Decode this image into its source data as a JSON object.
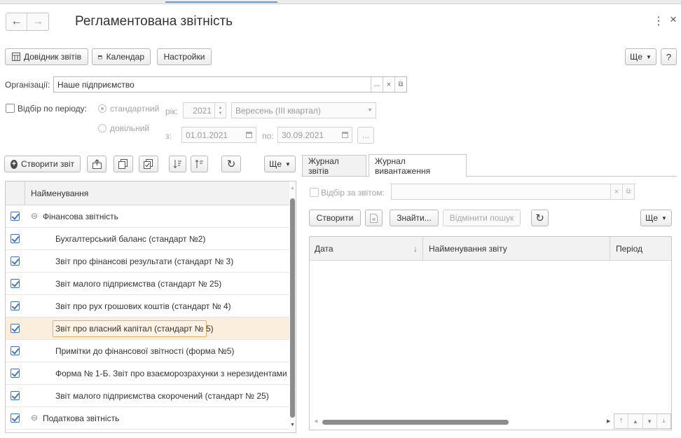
{
  "window": {
    "title": "Регламентована звітність",
    "back_icon": "←",
    "forward_icon": "→",
    "more_icon": "⋮",
    "close_icon": "×"
  },
  "toolbar": {
    "reports_ref_label": "Довідник звітів",
    "calendar_label": "Календар",
    "settings_label": "Настройки",
    "more_label": "Ще",
    "help_label": "?"
  },
  "organization": {
    "label": "Організації:",
    "value": "Наше підприємство",
    "select_icon": "...",
    "clear_icon": "×",
    "open_icon": "⧉"
  },
  "period_filter": {
    "checkbox_label": "Відбір по періоду:",
    "standard_label": "стандартний",
    "custom_label": "довільний",
    "year_label": "рік:",
    "year_value": "2021",
    "quarter_value": "Вересень (III квартал)",
    "from_label": "з:",
    "from_value": "01.01.2021",
    "to_label": "по:",
    "to_value": "30.09.2021",
    "ellipsis": "..."
  },
  "left_toolbar": {
    "create_label": "Створити звіт",
    "more_label": "Ще"
  },
  "tree": {
    "column_header": "Найменування",
    "rows": [
      {
        "label": "Фінансова звітність",
        "group": true,
        "checked": true
      },
      {
        "label": "Бухгалтерський баланс (стандарт №2)",
        "group": false,
        "checked": true
      },
      {
        "label": "Звіт про фінансові результати (стандарт № 3)",
        "group": false,
        "checked": true
      },
      {
        "label": "Звіт малого підприємства (стандарт № 25)",
        "group": false,
        "checked": true
      },
      {
        "label": "Звіт про рух грошових коштів (стандарт № 4)",
        "group": false,
        "checked": true
      },
      {
        "label": "Звіт про власний капітал (стандарт № 5)",
        "group": false,
        "checked": true,
        "selected": true
      },
      {
        "label": "Примітки до фінансової звітності (форма №5)",
        "group": false,
        "checked": true
      },
      {
        "label": "Форма № 1-Б. Звіт про взаєморозрахунки з нерезидентами",
        "group": false,
        "checked": true
      },
      {
        "label": "Звіт малого підприємства скорочений (стандарт № 25)",
        "group": false,
        "checked": true
      },
      {
        "label": "Податкова звітність",
        "group": true,
        "checked": true
      }
    ]
  },
  "tabs": {
    "reports_journal": "Журнал звітів",
    "export_journal": "Журнал вивантаження"
  },
  "journal": {
    "filter_label": "Відбір за звітом:",
    "filter_value": "",
    "create_label": "Створити",
    "find_label": "Знайти...",
    "cancel_search_label": "Відмінити пошук",
    "more_label": "Ще",
    "columns": {
      "date": "Дата",
      "report_name": "Найменування звіту",
      "period": "Період"
    },
    "sort_icon": "↓"
  },
  "colors": {
    "selected_row_bg": "#fbeedd",
    "selected_row_border": "#e9b06c",
    "checkbox_blue": "#3b76c4"
  }
}
